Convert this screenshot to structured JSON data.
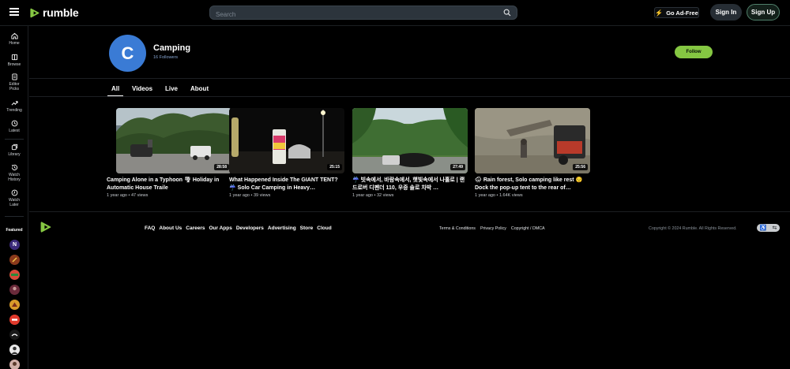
{
  "header": {
    "logo_text": "rumble",
    "search_placeholder": "Search",
    "go_ad_free": "Go Ad-Free",
    "sign_in": "Sign In",
    "sign_up": "Sign Up"
  },
  "sidebar": {
    "items": [
      {
        "label": "Home",
        "icon": "home-icon"
      },
      {
        "label": "Browse",
        "icon": "browse-icon"
      },
      {
        "label": "Editor Picks",
        "icon": "editor-picks-icon"
      },
      {
        "label": "Trending",
        "icon": "trending-icon"
      },
      {
        "label": "Latest",
        "icon": "clock-icon"
      },
      {
        "label": "Library",
        "icon": "library-icon"
      },
      {
        "label": "Watch History",
        "icon": "history-icon"
      },
      {
        "label": "Watch Later",
        "icon": "watch-later-icon"
      }
    ],
    "featured_label": "Featured",
    "featured_letters": [
      "N",
      "",
      "",
      "",
      "",
      "",
      "",
      "",
      ""
    ]
  },
  "channel": {
    "avatar_letter": "C",
    "name": "Camping",
    "followers": "16 Followers",
    "follow_label": "Follow",
    "avatar_color": "#3a7bd5"
  },
  "tabs": [
    "All",
    "Videos",
    "Live",
    "About"
  ],
  "videos": [
    {
      "title": "Camping Alone in a Typhoon 🌪 Holiday in Automatic House Traile",
      "meta": "1 year ago • 47 views",
      "duration": "28:58"
    },
    {
      "title": "What Happened Inside The GIANT TENT? ☔ Solo Car Camping in Heavy…",
      "meta": "1 year ago • 39 views",
      "duration": "25:15"
    },
    {
      "title": "☔ 빗속에서, 바람속에서, 햇빛속에서 나홀로 | 랜드로버 디펜더 110, 우중 솔로 차박 …",
      "meta": "1 year ago • 32 views",
      "duration": "27:49"
    },
    {
      "title": "🌧 Rain forest, Solo camping like rest 😌 Dock the pop-up tent to the rear of…",
      "meta": "1 year ago • 1.64K views",
      "duration": "25:56"
    }
  ],
  "footer": {
    "links": [
      "FAQ",
      "About Us",
      "Careers",
      "Our Apps",
      "Developers",
      "Advertising",
      "Store",
      "Cloud"
    ],
    "legal": [
      "Terms & Conditions",
      "Privacy Policy",
      "Copyright / DMCA"
    ],
    "copyright": "Copyright © 2024 Rumble. All Rights Reserved."
  },
  "colors": {
    "accent": "#85c742",
    "search_bg": "#2c343c",
    "background": "#000000"
  }
}
